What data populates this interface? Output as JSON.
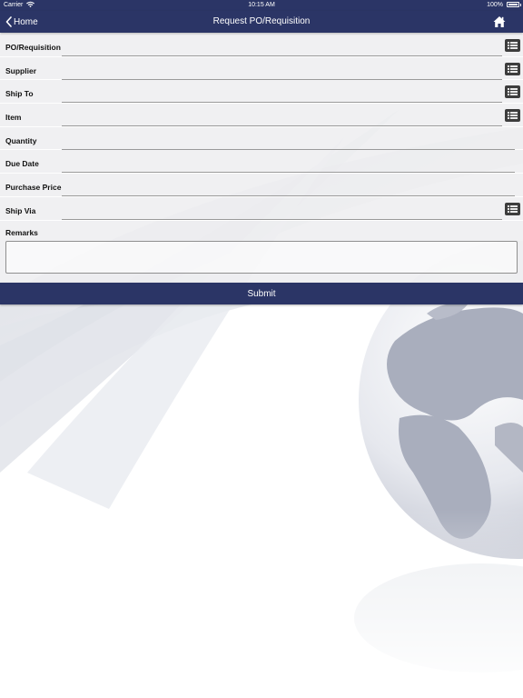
{
  "status_bar": {
    "carrier": "Carrier",
    "time": "10:15 AM",
    "battery": "100%",
    "wifi_icon": "wifi-icon",
    "battery_icon": "battery-icon"
  },
  "nav": {
    "back_label": "Home",
    "back_icon": "chevron-left-icon",
    "title": "Request PO/Requisition",
    "home_icon": "home-icon",
    "color": "#2b3566"
  },
  "form": {
    "fields": [
      {
        "label": "PO/Requisition",
        "value": "",
        "has_picker": true
      },
      {
        "label": "Supplier",
        "value": "",
        "has_picker": true
      },
      {
        "label": "Ship To",
        "value": "",
        "has_picker": true
      },
      {
        "label": "Item",
        "value": "",
        "has_picker": true
      },
      {
        "label": "Quantity",
        "value": "",
        "has_picker": false
      },
      {
        "label": "Due Date",
        "value": "",
        "has_picker": false
      },
      {
        "label": "Purchase Price",
        "value": "",
        "has_picker": false
      },
      {
        "label": "Ship Via",
        "value": "",
        "has_picker": true
      }
    ],
    "picker_icon": "list-icon",
    "remarks_label": "Remarks",
    "remarks_value": ""
  },
  "submit_label": "Submit"
}
